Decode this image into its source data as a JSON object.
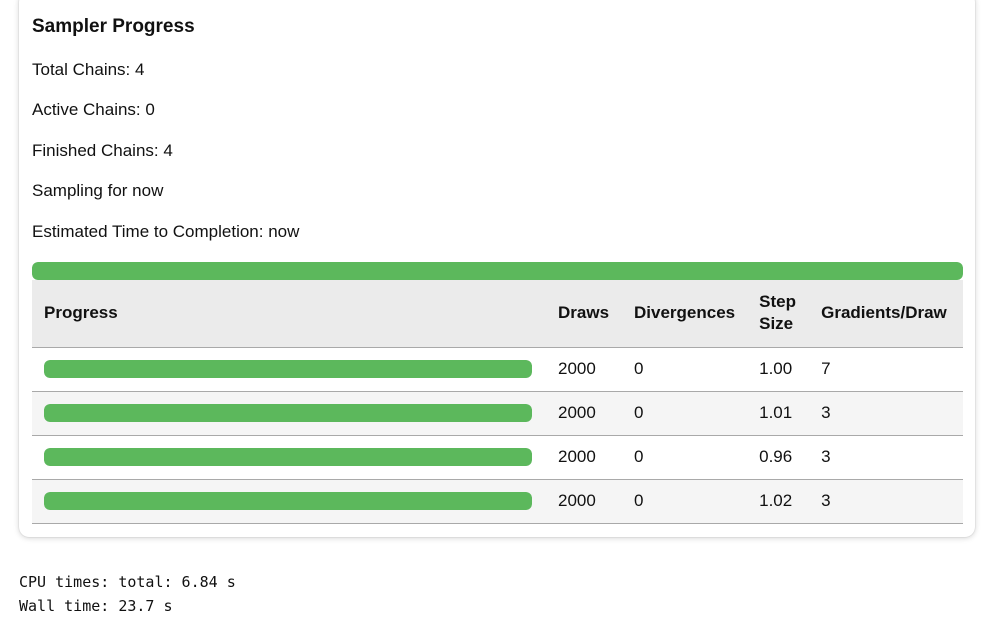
{
  "panel": {
    "title": "Sampler Progress",
    "total_chains": "Total Chains: 4",
    "active_chains": "Active Chains: 0",
    "finished_chains": "Finished Chains: 4",
    "sampling_for": "Sampling for now",
    "eta": "Estimated Time to Completion: now",
    "overall_progress": 1.0,
    "progress_color": "#5cb85c"
  },
  "table": {
    "headers": {
      "progress": "Progress",
      "draws": "Draws",
      "divergences": "Divergences",
      "step_size_line1": "Step",
      "step_size_line2": "Size",
      "gradients": "Gradients/Draw"
    },
    "rows": [
      {
        "progress": 1.0,
        "draws": "2000",
        "divergences": "0",
        "step_size": "1.00",
        "gradients": "7"
      },
      {
        "progress": 1.0,
        "draws": "2000",
        "divergences": "0",
        "step_size": "1.01",
        "gradients": "3"
      },
      {
        "progress": 1.0,
        "draws": "2000",
        "divergences": "0",
        "step_size": "0.96",
        "gradients": "3"
      },
      {
        "progress": 1.0,
        "draws": "2000",
        "divergences": "0",
        "step_size": "1.02",
        "gradients": "3"
      }
    ]
  },
  "output": {
    "cpu_times": "CPU times: total: 6.84 s",
    "wall_time": "Wall time: 23.7 s"
  }
}
